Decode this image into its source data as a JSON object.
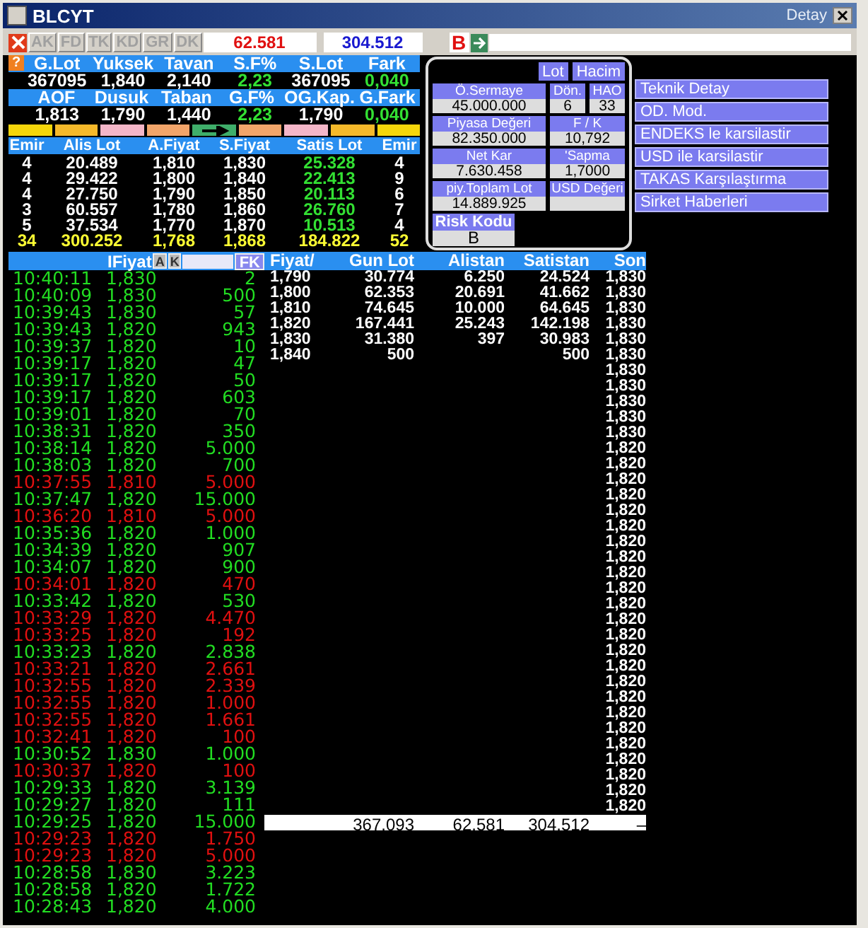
{
  "window": {
    "title": "BLCYT",
    "detail_label": "Detay"
  },
  "toolbar": {
    "tabs": [
      {
        "label": "AK",
        "disabled": true
      },
      {
        "label": "FD",
        "disabled": true
      },
      {
        "label": "TK",
        "disabled": true
      },
      {
        "label": "KD",
        "disabled": true
      },
      {
        "label": "GR",
        "disabled": true
      },
      {
        "label": "DK",
        "disabled": true
      }
    ],
    "value_1": "62.581",
    "value_2": "304.512",
    "flag": "B"
  },
  "summary": {
    "help_label": "?",
    "rows": [
      {
        "kind": "header",
        "cells": [
          {
            "text": "G.Lot"
          },
          {
            "text": "Yuksek"
          },
          {
            "text": "Tavan"
          },
          {
            "text": "S.F%"
          },
          {
            "text": "S.Lot"
          },
          {
            "text": "Fark"
          }
        ]
      },
      {
        "kind": "values",
        "cells": [
          {
            "text": "367095",
            "rising": false
          },
          {
            "text": "1,840",
            "rising": false
          },
          {
            "text": "2,140",
            "rising": false
          },
          {
            "text": "2,23",
            "rising": true
          },
          {
            "text": "367095",
            "rising": false
          },
          {
            "text": "0,040",
            "rising": true
          }
        ]
      },
      {
        "kind": "header",
        "cells": [
          {
            "text": "AOF"
          },
          {
            "text": "Dusuk"
          },
          {
            "text": "Taban"
          },
          {
            "text": "G.F%"
          },
          {
            "text": "OG.Kap."
          },
          {
            "text": "G.Fark"
          }
        ]
      },
      {
        "kind": "values",
        "cells": [
          {
            "text": "1,813",
            "rising": false
          },
          {
            "text": "1,790",
            "rising": false
          },
          {
            "text": "1,440",
            "rising": false
          },
          {
            "text": "2,23",
            "rising": true
          },
          {
            "text": "1,790",
            "rising": false
          },
          {
            "text": "0,040",
            "rising": true
          }
        ]
      }
    ]
  },
  "color_bar": [
    {
      "color": "#f5d60a",
      "arrow": false
    },
    {
      "color": "#f5b92a",
      "arrow": false
    },
    {
      "color": "#f4b6c8",
      "arrow": false
    },
    {
      "color": "#f2a56a",
      "arrow": false
    },
    {
      "color": "#3fae6a",
      "arrow": true
    },
    {
      "color": "#f2a56a",
      "arrow": false
    },
    {
      "color": "#f4b6c8",
      "arrow": false
    },
    {
      "color": "#f5b92a",
      "arrow": false
    },
    {
      "color": "#f5d60a",
      "arrow": false
    }
  ],
  "order_book": {
    "columns": [
      "Emir",
      "Alis Lot",
      "A.Fiyat",
      "S.Fiyat",
      "Satis Lot",
      "Emir"
    ],
    "rows": [
      [
        "4",
        "20.489",
        "1,810",
        "1,830",
        "25.328",
        "4"
      ],
      [
        "4",
        "29.422",
        "1,800",
        "1,840",
        "22.413",
        "9"
      ],
      [
        "4",
        "27.750",
        "1,790",
        "1,850",
        "20.113",
        "6"
      ],
      [
        "3",
        "60.557",
        "1,780",
        "1,860",
        "26.760",
        "7"
      ],
      [
        "5",
        "37.534",
        "1,770",
        "1,870",
        "10.513",
        "4"
      ]
    ],
    "total": [
      "34",
      "300.252",
      "1,768",
      "1,868",
      "184.822",
      "52"
    ]
  },
  "info_panel": {
    "toggles": [
      "Lot",
      "Hacim"
    ],
    "rows": [
      [
        {
          "label": "Ö.Sermaye",
          "value": "45.000.000"
        },
        {
          "label": "Dön.",
          "value": "6"
        },
        {
          "label": "HAO",
          "value": "33"
        }
      ],
      [
        {
          "label": "Piyasa Değeri",
          "value": "82.350.000"
        },
        {
          "label": "F / K",
          "value": "10,792"
        }
      ],
      [
        {
          "label": "Net Kar",
          "value": "7.630.458"
        },
        {
          "label": "'Sapma",
          "value": "1,7000"
        }
      ],
      [
        {
          "label": "piy.Toplam Lot",
          "value": "14.889.925"
        },
        {
          "label": "USD Değeri"
        }
      ]
    ],
    "risk": {
      "label": "Risk Kodu",
      "value": "B"
    }
  },
  "links": [
    "Teknik Detay",
    "OD. Mod.",
    "ENDEKS le karsilastir",
    "USD ile karsilastir",
    "TAKAS Karşılaştırma",
    "Sirket Haberleri"
  ],
  "trades": {
    "header": {
      "label": "IFiyat",
      "buttons": [
        "A",
        "K"
      ],
      "filter_button": "FK"
    },
    "rows": [
      {
        "time": "10:40:11",
        "price": "1,830",
        "lot": "2",
        "rising": true
      },
      {
        "time": "10:40:09",
        "price": "1,830",
        "lot": "500",
        "rising": true
      },
      {
        "time": "10:39:43",
        "price": "1,830",
        "lot": "57",
        "rising": true
      },
      {
        "time": "10:39:43",
        "price": "1,820",
        "lot": "943",
        "rising": true
      },
      {
        "time": "10:39:37",
        "price": "1,820",
        "lot": "10",
        "rising": true
      },
      {
        "time": "10:39:17",
        "price": "1,820",
        "lot": "47",
        "rising": true
      },
      {
        "time": "10:39:17",
        "price": "1,820",
        "lot": "50",
        "rising": true
      },
      {
        "time": "10:39:17",
        "price": "1,820",
        "lot": "603",
        "rising": true
      },
      {
        "time": "10:39:01",
        "price": "1,820",
        "lot": "70",
        "rising": true
      },
      {
        "time": "10:38:31",
        "price": "1,820",
        "lot": "350",
        "rising": true
      },
      {
        "time": "10:38:14",
        "price": "1,820",
        "lot": "5.000",
        "rising": true
      },
      {
        "time": "10:38:03",
        "price": "1,820",
        "lot": "700",
        "rising": true
      },
      {
        "time": "10:37:55",
        "price": "1,810",
        "lot": "5.000",
        "rising": false
      },
      {
        "time": "10:37:47",
        "price": "1,820",
        "lot": "15.000",
        "rising": true
      },
      {
        "time": "10:36:20",
        "price": "1,810",
        "lot": "5.000",
        "rising": false
      },
      {
        "time": "10:35:36",
        "price": "1,820",
        "lot": "1.000",
        "rising": true
      },
      {
        "time": "10:34:39",
        "price": "1,820",
        "lot": "907",
        "rising": true
      },
      {
        "time": "10:34:07",
        "price": "1,820",
        "lot": "900",
        "rising": true
      },
      {
        "time": "10:34:01",
        "price": "1,820",
        "lot": "470",
        "rising": false
      },
      {
        "time": "10:33:42",
        "price": "1,820",
        "lot": "530",
        "rising": true
      },
      {
        "time": "10:33:29",
        "price": "1,820",
        "lot": "4.470",
        "rising": false
      },
      {
        "time": "10:33:25",
        "price": "1,820",
        "lot": "192",
        "rising": false
      },
      {
        "time": "10:33:23",
        "price": "1,820",
        "lot": "2.838",
        "rising": true
      },
      {
        "time": "10:33:21",
        "price": "1,820",
        "lot": "2.661",
        "rising": false
      },
      {
        "time": "10:32:55",
        "price": "1,820",
        "lot": "2.339",
        "rising": false
      },
      {
        "time": "10:32:55",
        "price": "1,820",
        "lot": "1.000",
        "rising": false
      },
      {
        "time": "10:32:55",
        "price": "1,820",
        "lot": "1.661",
        "rising": false
      },
      {
        "time": "10:32:41",
        "price": "1,820",
        "lot": "100",
        "rising": false
      },
      {
        "time": "10:30:52",
        "price": "1,830",
        "lot": "1.000",
        "rising": true
      },
      {
        "time": "10:30:37",
        "price": "1,820",
        "lot": "100",
        "rising": false
      },
      {
        "time": "10:29:33",
        "price": "1,820",
        "lot": "3.139",
        "rising": true
      },
      {
        "time": "10:29:27",
        "price": "1,820",
        "lot": "111",
        "rising": true
      },
      {
        "time": "10:29:25",
        "price": "1,820",
        "lot": "15.000",
        "rising": true
      },
      {
        "time": "10:29:23",
        "price": "1,820",
        "lot": "1.750",
        "rising": false
      },
      {
        "time": "10:29:23",
        "price": "1,820",
        "lot": "5.000",
        "rising": false
      },
      {
        "time": "10:28:58",
        "price": "1,830",
        "lot": "3.223",
        "rising": true
      },
      {
        "time": "10:28:58",
        "price": "1,820",
        "lot": "1.722",
        "rising": true
      },
      {
        "time": "10:28:43",
        "price": "1,820",
        "lot": "4.000",
        "rising": true
      }
    ]
  },
  "price_table": {
    "columns": [
      "Fiyat/",
      "Gun Lot",
      "Alistan",
      "Satistan",
      "Son"
    ],
    "rows": [
      [
        "1,790",
        "30.774",
        "6.250",
        "24.524"
      ],
      [
        "1,800",
        "62.353",
        "20.691",
        "41.662"
      ],
      [
        "1,810",
        "74.645",
        "10.000",
        "64.645"
      ],
      [
        "1,820",
        "167.441",
        "25.243",
        "142.198"
      ],
      [
        "1,830",
        "31.380",
        "397",
        "30.983"
      ],
      [
        "1,840",
        "500",
        "",
        "500"
      ]
    ],
    "last_prices": [
      "1,830",
      "1,830",
      "1,830",
      "1,830",
      "1,830",
      "1,830",
      "1,830",
      "1,830",
      "1,830",
      "1,830",
      "1,830",
      "1,820",
      "1,820",
      "1,820",
      "1,820",
      "1,820",
      "1,820",
      "1,820",
      "1,820",
      "1,820",
      "1,820",
      "1,820",
      "1,820",
      "1,820",
      "1,820",
      "1,820",
      "1,820",
      "1,820",
      "1,820",
      "1,820",
      "1,820",
      "1,820",
      "1,820",
      "1,820",
      "1,820"
    ],
    "totals": [
      "367.093",
      "62.581",
      "304.512",
      "–"
    ]
  }
}
